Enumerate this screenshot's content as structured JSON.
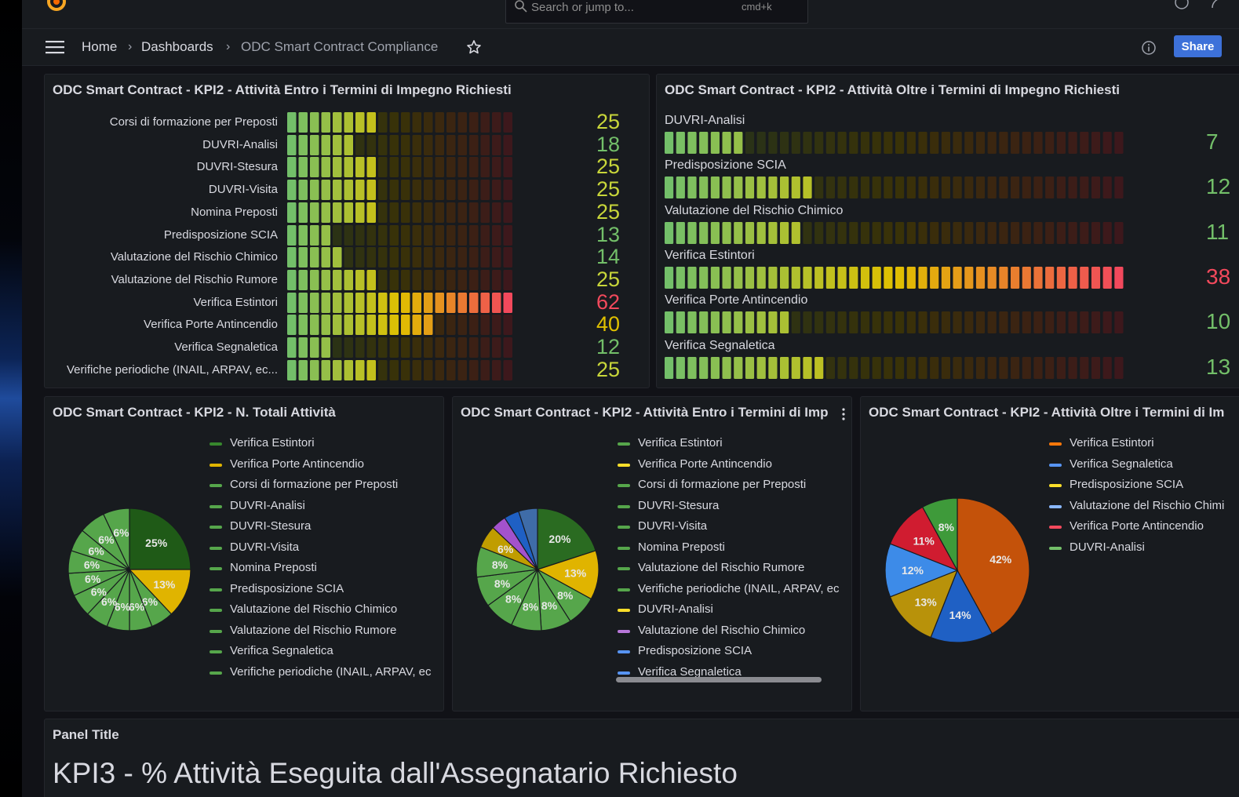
{
  "header": {
    "search_placeholder": "Search or jump to...",
    "search_shortcut": "cmd+k"
  },
  "nav": {
    "breadcrumbs": [
      "Home",
      "Dashboards",
      "ODC Smart Contract Compliance"
    ],
    "share_label": "Share"
  },
  "panels": {
    "entro_bars": {
      "title": "ODC Smart Contract - KPI2 - Attività Entro i Termini di Impegno Richiesti",
      "rows": [
        {
          "label": "Corsi di formazione per Preposti",
          "value": "25"
        },
        {
          "label": "DUVRI-Analisi",
          "value": "18"
        },
        {
          "label": "DUVRI-Stesura",
          "value": "25"
        },
        {
          "label": "DUVRI-Visita",
          "value": "25"
        },
        {
          "label": "Nomina Preposti",
          "value": "25"
        },
        {
          "label": "Predisposizione SCIA",
          "value": "13"
        },
        {
          "label": "Valutazione del Rischio Chimico",
          "value": "14"
        },
        {
          "label": "Valutazione del Rischio Rumore",
          "value": "25"
        },
        {
          "label": "Verifica Estintori",
          "value": "62"
        },
        {
          "label": "Verifica Porte Antincendio",
          "value": "40"
        },
        {
          "label": "Verifica Segnaletica",
          "value": "12"
        },
        {
          "label": "Verifiche periodiche (INAIL, ARPAV, ec...",
          "value": "25"
        }
      ]
    },
    "oltre_bars": {
      "title": "ODC Smart Contract - KPI2 - Attività Oltre i Termini di Impegno Richiesti",
      "rows": [
        {
          "label": "DUVRI-Analisi",
          "value": "7"
        },
        {
          "label": "Predisposizione SCIA",
          "value": "12"
        },
        {
          "label": "Valutazione del Rischio Chimico",
          "value": "11"
        },
        {
          "label": "Verifica Estintori",
          "value": "38"
        },
        {
          "label": "Verifica Porte Antincendio",
          "value": "10"
        },
        {
          "label": "Verifica Segnaletica",
          "value": "13"
        }
      ]
    },
    "totali_pie": {
      "title": "ODC Smart Contract - KPI2 - N. Totali Attività",
      "legend": [
        {
          "label": "Verifica Estintori",
          "color": "#37872d"
        },
        {
          "label": "Verifica Porte Antincendio",
          "color": "#e0b400"
        },
        {
          "label": "Corsi di formazione per Preposti",
          "color": "#56a64b"
        },
        {
          "label": "DUVRI-Analisi",
          "color": "#56a64b"
        },
        {
          "label": "DUVRI-Stesura",
          "color": "#56a64b"
        },
        {
          "label": "DUVRI-Visita",
          "color": "#56a64b"
        },
        {
          "label": "Nomina Preposti",
          "color": "#56a64b"
        },
        {
          "label": "Predisposizione SCIA",
          "color": "#56a64b"
        },
        {
          "label": "Valutazione del Rischio Chimico",
          "color": "#56a64b"
        },
        {
          "label": "Valutazione del Rischio Rumore",
          "color": "#56a64b"
        },
        {
          "label": "Verifica Segnaletica",
          "color": "#56a64b"
        },
        {
          "label": "Verifiche periodiche (INAIL, ARPAV, ec",
          "color": "#56a64b"
        }
      ]
    },
    "entro_pie": {
      "title": "ODC Smart Contract - KPI2 - Attività Entro i Termini di Imp",
      "legend": [
        {
          "label": "Verifica Estintori",
          "color": "#56a64b"
        },
        {
          "label": "Verifica Porte Antincendio",
          "color": "#fade2a"
        },
        {
          "label": "Corsi di formazione per Preposti",
          "color": "#56a64b"
        },
        {
          "label": "DUVRI-Stesura",
          "color": "#56a64b"
        },
        {
          "label": "DUVRI-Visita",
          "color": "#56a64b"
        },
        {
          "label": "Nomina Preposti",
          "color": "#56a64b"
        },
        {
          "label": "Valutazione del Rischio Rumore",
          "color": "#56a64b"
        },
        {
          "label": "Verifiche periodiche (INAIL, ARPAV, ec",
          "color": "#56a64b"
        },
        {
          "label": "DUVRI-Analisi",
          "color": "#fade2a"
        },
        {
          "label": "Valutazione del Rischio Chimico",
          "color": "#b877d9"
        },
        {
          "label": "Predisposizione SCIA",
          "color": "#5794f2"
        },
        {
          "label": "Verifica Segnaletica",
          "color": "#5794f2"
        }
      ]
    },
    "oltre_pie": {
      "title": "ODC Smart Contract - KPI2 - Attività Oltre i Termini di Im",
      "legend": [
        {
          "label": "Verifica Estintori",
          "color": "#ff780a"
        },
        {
          "label": "Verifica Segnaletica",
          "color": "#5794f2"
        },
        {
          "label": "Predisposizione SCIA",
          "color": "#fade2a"
        },
        {
          "label": "Valutazione del Rischio Chimi",
          "color": "#8ab8ff"
        },
        {
          "label": "Verifica Porte Antincendio",
          "color": "#f2495c"
        },
        {
          "label": "DUVRI-Analisi",
          "color": "#73bf69"
        }
      ]
    },
    "kpi3": {
      "title": "Panel Title",
      "text": "KPI3 - % Attività Eseguita dall'Assegnatario Richiesto"
    }
  },
  "chart_data": [
    {
      "type": "bar",
      "title": "ODC Smart Contract - KPI2 - Attività Entro i Termini di Impegno Richiesti",
      "categories": [
        "Corsi di formazione per Preposti",
        "DUVRI-Analisi",
        "DUVRI-Stesura",
        "DUVRI-Visita",
        "Nomina Preposti",
        "Predisposizione SCIA",
        "Valutazione del Rischio Chimico",
        "Valutazione del Rischio Rumore",
        "Verifica Estintori",
        "Verifica Porte Antincendio",
        "Verifica Segnaletica",
        "Verifiche periodiche (INAIL, ARPAV, ec..."
      ],
      "values": [
        25,
        18,
        25,
        25,
        25,
        13,
        14,
        25,
        62,
        40,
        12,
        25
      ],
      "max": 62,
      "cells": 20
    },
    {
      "type": "bar",
      "title": "ODC Smart Contract - KPI2 - Attività Oltre i Termini di Impegno Richiesti",
      "categories": [
        "DUVRI-Analisi",
        "Predisposizione SCIA",
        "Valutazione del Rischio Chimico",
        "Verifica Estintori",
        "Verifica Porte Antincendio",
        "Verifica Segnaletica"
      ],
      "values": [
        7,
        12,
        11,
        38,
        10,
        13
      ],
      "max": 38,
      "cells": 40
    },
    {
      "type": "pie",
      "title": "ODC Smart Contract - KPI2 - N. Totali Attività",
      "slices": [
        {
          "value": 25,
          "color": "#1f5a17",
          "label": "25%"
        },
        {
          "value": 13,
          "color": "#e0b400",
          "label": "13%"
        },
        {
          "value": 6,
          "color": "#56a64b",
          "label": "6%"
        },
        {
          "value": 6,
          "color": "#56a64b",
          "label": "6%"
        },
        {
          "value": 6,
          "color": "#56a64b",
          "label": "6%"
        },
        {
          "value": 6,
          "color": "#56a64b",
          "label": "6%"
        },
        {
          "value": 6,
          "color": "#56a64b",
          "label": "6%"
        },
        {
          "value": 6,
          "color": "#56a64b",
          "label": "6%"
        },
        {
          "value": 6,
          "color": "#56a64b",
          "label": "6%"
        },
        {
          "value": 6,
          "color": "#56a64b",
          "label": "6%"
        },
        {
          "value": 7,
          "color": "#56a64b",
          "label": "6%"
        },
        {
          "value": 7,
          "color": "#56a64b",
          "label": "6%"
        }
      ]
    },
    {
      "type": "pie",
      "title": "ODC Smart Contract - KPI2 - Attività Entro i Termini di Imp",
      "slices": [
        {
          "value": 20,
          "color": "#2a6b21",
          "label": "20%"
        },
        {
          "value": 13,
          "color": "#e0b400",
          "label": "13%"
        },
        {
          "value": 8,
          "color": "#56a64b",
          "label": "8%"
        },
        {
          "value": 8,
          "color": "#56a64b",
          "label": "8%"
        },
        {
          "value": 8,
          "color": "#56a64b",
          "label": "8%"
        },
        {
          "value": 8,
          "color": "#56a64b",
          "label": "8%"
        },
        {
          "value": 8,
          "color": "#56a64b",
          "label": "8%"
        },
        {
          "value": 8,
          "color": "#56a64b",
          "label": "8%"
        },
        {
          "value": 6,
          "color": "#c09d00",
          "label": "6%"
        },
        {
          "value": 4,
          "color": "#a352cc",
          "label": ""
        },
        {
          "value": 4,
          "color": "#1f60c4",
          "label": ""
        },
        {
          "value": 5,
          "color": "#3f6ca8",
          "label": ""
        }
      ]
    },
    {
      "type": "pie",
      "title": "ODC Smart Contract - KPI2 - Attività Oltre i Termini di Im",
      "slices": [
        {
          "value": 42,
          "color": "#c4520a",
          "label": "42%"
        },
        {
          "value": 14,
          "color": "#1f60c4",
          "label": "14%"
        },
        {
          "value": 13,
          "color": "#b8920a",
          "label": "13%"
        },
        {
          "value": 12,
          "color": "#3d8be8",
          "label": "12%"
        },
        {
          "value": 11,
          "color": "#d01c30",
          "label": "11%"
        },
        {
          "value": 8,
          "color": "#3e9a3a",
          "label": "8%"
        }
      ]
    }
  ]
}
